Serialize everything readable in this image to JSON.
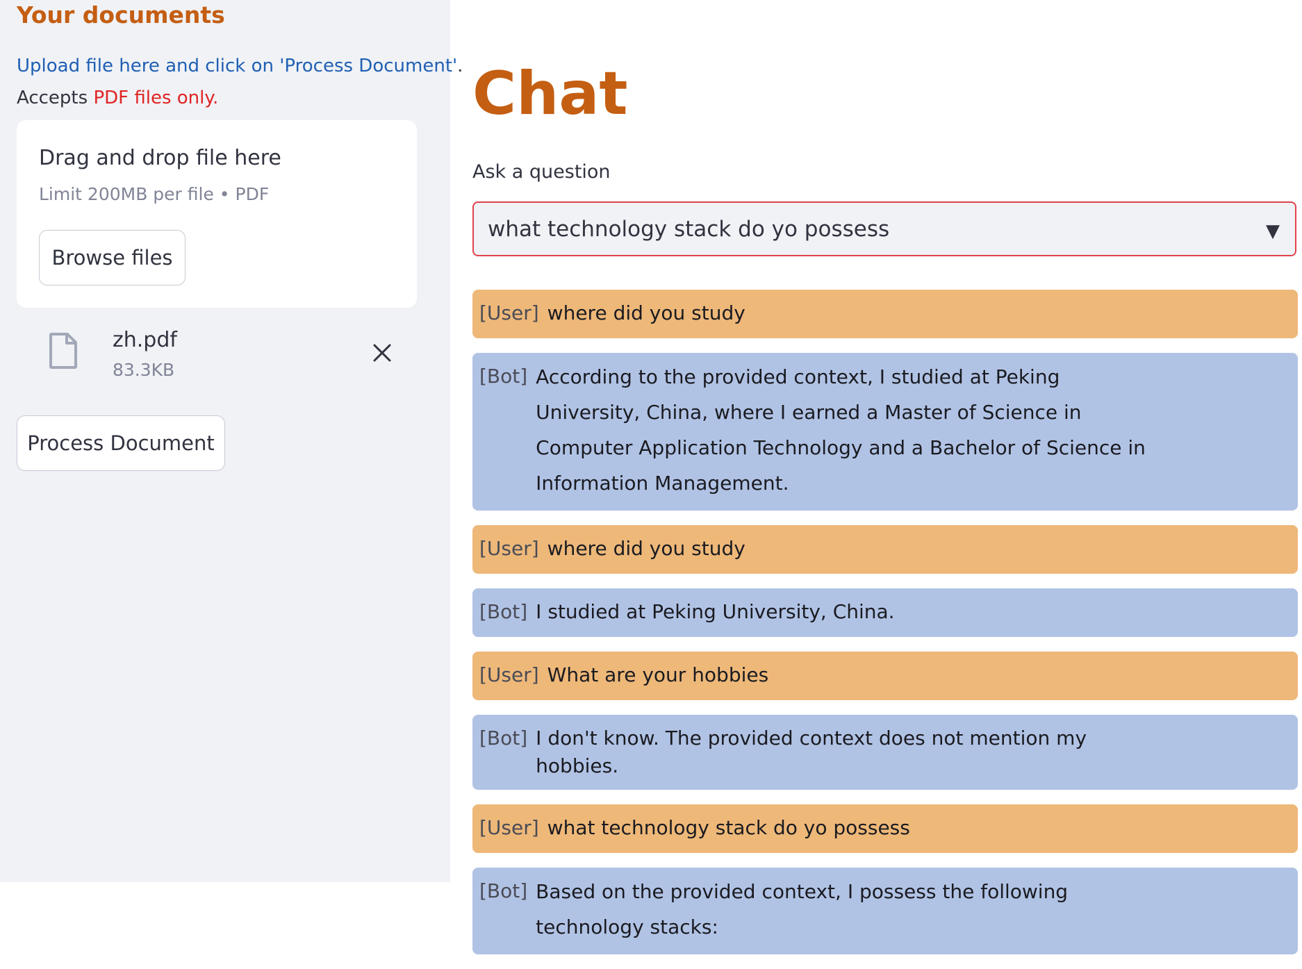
{
  "sidebar": {
    "title": "Your documents",
    "upload_hint": "Upload file here and click on 'Process Document'",
    "upload_hint_end": ".",
    "accepts_prefix": "Accepts",
    "accepts_highlight": "PDF files only.",
    "dropzone": {
      "title": "Drag and drop file here",
      "limit": "Limit 200MB per file • PDF",
      "browse_label": "Browse files"
    },
    "file": {
      "name": "zh.pdf",
      "size": "83.3KB",
      "icon": "file-icon",
      "remove_icon": "close-icon"
    },
    "process_label": "Process Document"
  },
  "main": {
    "title": "Chat",
    "question_label": "Ask a question",
    "question_value": "what technology stack do yo possess",
    "dropdown_icon": "▼",
    "messages": [
      {
        "role": "User",
        "tag": "[User]",
        "text": "where did you study"
      },
      {
        "role": "Bot",
        "tag": "[Bot]",
        "text": "According to the provided context, I studied at Peking University, China, where I earned a Master of Science in Computer Application Technology and a Bachelor of Science in Information Management."
      },
      {
        "role": "User",
        "tag": "[User]",
        "text": "where did you study"
      },
      {
        "role": "Bot",
        "tag": "[Bot]",
        "text": "I studied at Peking University, China."
      },
      {
        "role": "User",
        "tag": "[User]",
        "text": "What are your hobbies"
      },
      {
        "role": "Bot",
        "tag": "[Bot]",
        "text": "I don't know. The provided context does not mention my hobbies."
      },
      {
        "role": "User",
        "tag": "[User]",
        "text": "what technology stack do yo possess"
      },
      {
        "role": "Bot",
        "tag": "[Bot]",
        "text": "Based on the provided context, I possess the following technology stacks:"
      }
    ]
  },
  "colors": {
    "accent": "#c45e12",
    "link": "#1f5fb3",
    "warning": "#e02424",
    "user_bubble": "#eeb879",
    "bot_bubble": "#b1c3e5",
    "sidebar_bg": "#f0f2f6",
    "input_border": "#e0424a"
  }
}
